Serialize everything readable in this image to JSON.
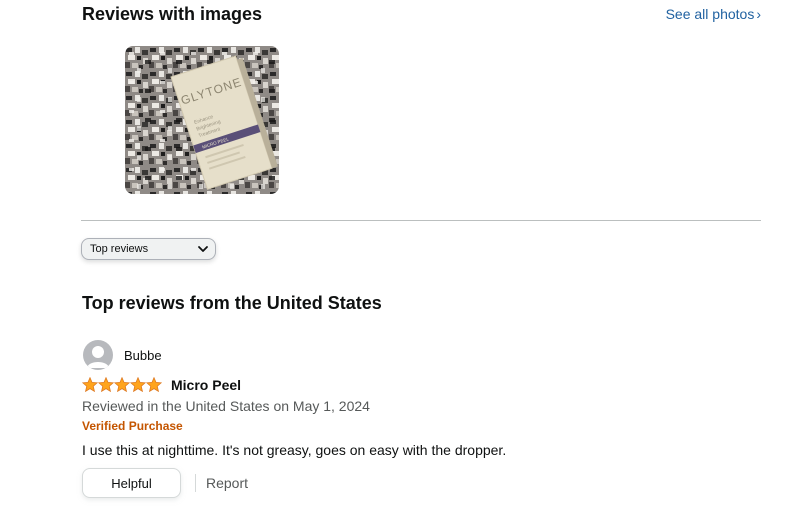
{
  "reviews_with_images": {
    "title": "Reviews with images",
    "see_all_label": "See all photos",
    "see_all_chevron": "›",
    "image": {
      "product_brand": "GLYTONE",
      "product_lines": [
        "Enhance",
        "Brightening",
        "Treatment"
      ],
      "product_band": "MICRO PEEL"
    }
  },
  "sort": {
    "selected": "Top reviews",
    "chevron_icon": "chevron-down-icon"
  },
  "top_reviews": {
    "title": "Top reviews from the United States",
    "reviews": [
      {
        "reviewer": "Bubbe",
        "rating": 5,
        "rating_max": 5,
        "star_color": "#ffa41c",
        "title": "Micro Peel",
        "date_line": "Reviewed in the United States on May 1, 2024",
        "verified": "Verified Purchase",
        "body": "I use this at nighttime. It's not greasy, goes on easy with the dropper.",
        "helpful_label": "Helpful",
        "report_label": "Report"
      }
    ]
  },
  "colors": {
    "link": "#2162a1",
    "verified": "#c45500",
    "muted": "#565959",
    "text": "#0f1111"
  }
}
